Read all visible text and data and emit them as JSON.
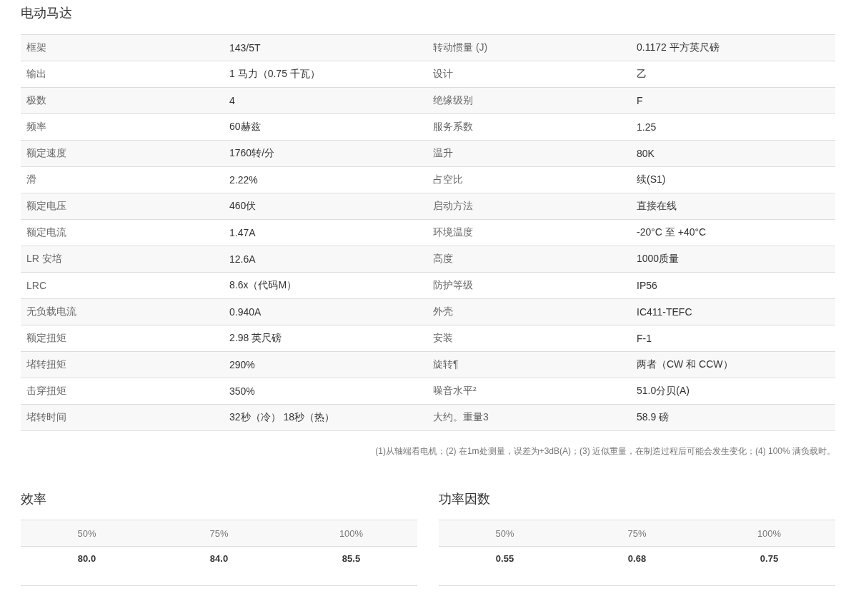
{
  "title": "电动马达",
  "specs": [
    [
      "框架",
      "143/5T",
      "转动惯量 (J)",
      "0.1172 平方英尺磅"
    ],
    [
      "输出",
      "1 马力（0.75 千瓦）",
      "设计",
      "乙"
    ],
    [
      "极数",
      "4",
      "绝缘级别",
      "F"
    ],
    [
      "频率",
      "60赫兹",
      "服务系数",
      "1.25"
    ],
    [
      "额定速度",
      "1760转/分",
      "温升",
      "80K"
    ],
    [
      "滑",
      "2.22%",
      "占空比",
      "续(S1)"
    ],
    [
      "额定电压",
      "460伏",
      "启动方法",
      "直接在线"
    ],
    [
      "额定电流",
      "1.47A",
      "环境温度",
      "-20°C 至 +40°C"
    ],
    [
      "LR 安培",
      "12.6A",
      "高度",
      "1000质量"
    ],
    [
      "LRC",
      "8.6x（代码M）",
      "防护等级",
      "IP56"
    ],
    [
      "无负载电流",
      "0.940A",
      "外壳",
      "IC411-TEFC"
    ],
    [
      "额定扭矩",
      "2.98 英尺磅",
      "安装",
      "F-1"
    ],
    [
      "堵转扭矩",
      "290%",
      "旋转¶",
      "两者（CW 和 CCW）"
    ],
    [
      "击穿扭矩",
      "350%",
      "噪音水平²",
      "51.0分贝(A)"
    ],
    [
      "堵转时间",
      "32秒（冷） 18秒（热）",
      "大约。重量3",
      "58.9 磅"
    ]
  ],
  "footnote": "(1)从轴端看电机；(2) 在1m处测量，误差为+3dB(A)；(3) 近似重量，在制造过程后可能会发生变化；(4) 100% 满负载时。",
  "load_tables": [
    {
      "title": "效率",
      "headers": [
        "50%",
        "75%",
        "100%"
      ],
      "values": [
        "80.0",
        "84.0",
        "85.5"
      ]
    },
    {
      "title": "功率因数",
      "headers": [
        "50%",
        "75%",
        "100%"
      ],
      "values": [
        "0.55",
        "0.68",
        "0.75"
      ]
    }
  ]
}
